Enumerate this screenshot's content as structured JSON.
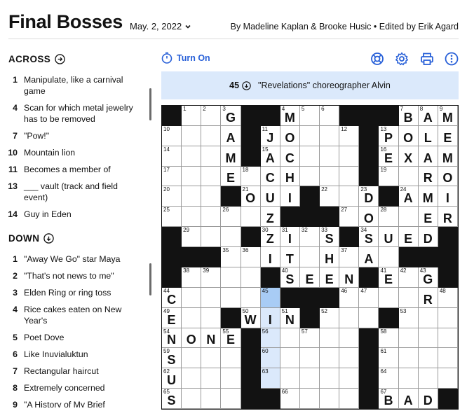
{
  "header": {
    "title": "Final Bosses",
    "date": "May. 2, 2022",
    "byline": "By Madeline Kaplan & Brooke Husic • Edited by Erik Agard"
  },
  "across": {
    "heading": "ACROSS",
    "clues": [
      {
        "num": "1",
        "text": "Manipulate, like a carnival game"
      },
      {
        "num": "4",
        "text": "Scan for which metal jewelry has to be removed"
      },
      {
        "num": "7",
        "text": "\"Pow!\""
      },
      {
        "num": "10",
        "text": "Mountain lion"
      },
      {
        "num": "11",
        "text": "Becomes a member of"
      },
      {
        "num": "13",
        "text": "___ vault (track and field event)"
      },
      {
        "num": "14",
        "text": "Guy in Eden"
      }
    ]
  },
  "down": {
    "heading": "DOWN",
    "clues": [
      {
        "num": "1",
        "text": "\"Away We Go\" star Maya"
      },
      {
        "num": "2",
        "text": "\"That's not news to me\""
      },
      {
        "num": "3",
        "text": "Elden Ring or ring toss"
      },
      {
        "num": "4",
        "text": "Rice cakes eaten on New Year's"
      },
      {
        "num": "5",
        "text": "Poet Dove"
      },
      {
        "num": "6",
        "text": "Like Inuvialuktun"
      },
      {
        "num": "7",
        "text": "Rectangular haircut"
      },
      {
        "num": "8",
        "text": "Extremely concerned"
      },
      {
        "num": "9",
        "text": "\"A History of My Brief"
      }
    ]
  },
  "toolbar": {
    "turn_on_label": "Turn On",
    "icons": [
      "timer-icon",
      "help-lifebuoy-icon",
      "settings-gear-icon",
      "print-icon",
      "more-vertical-icon"
    ]
  },
  "active_clue": {
    "num": "45",
    "direction": "down",
    "text": "\"Revelations\" choreographer Alvin"
  },
  "colors": {
    "accent": "#2860d8",
    "highlight": "#dbe9fb",
    "selected": "#a8ccf5",
    "block": "#121212"
  },
  "grid": {
    "rows": [
      "#123G#4M56##7B89",
      "10    11J 12#13P   ",
      "14    M 15AC  #16EXAM",
      "17    E 18 CH  #19 RO",
      "20  # 21OUI# 22 23D#24AMI",
      "25  26  Z##27 O28  ER",
      "#29  #30Z31I32 33S#34SUED#",
      "###35 36 IT H37A###",
      "#38 39 #40SEEN#41E42G43G#",
      "44C  45 ## 46 47 R48",
      "49E #50W I51N52 #53  ",
      "54NONE55E#56 57  #58   ",
      "59S   #60   #61   ",
      "62U   #63   #64   ",
      "65S   ##66  ##67BAD#"
    ],
    "cells": [
      [
        "#",
        "1",
        "2",
        "3G",
        "#",
        "4M",
        "5",
        "6",
        "#",
        "#",
        "7B",
        "8A",
        "9M",
        "#",
        "#"
      ],
      [],
      [],
      [],
      [],
      [],
      [],
      [],
      [],
      [],
      [],
      [],
      [],
      [],
      []
    ]
  }
}
